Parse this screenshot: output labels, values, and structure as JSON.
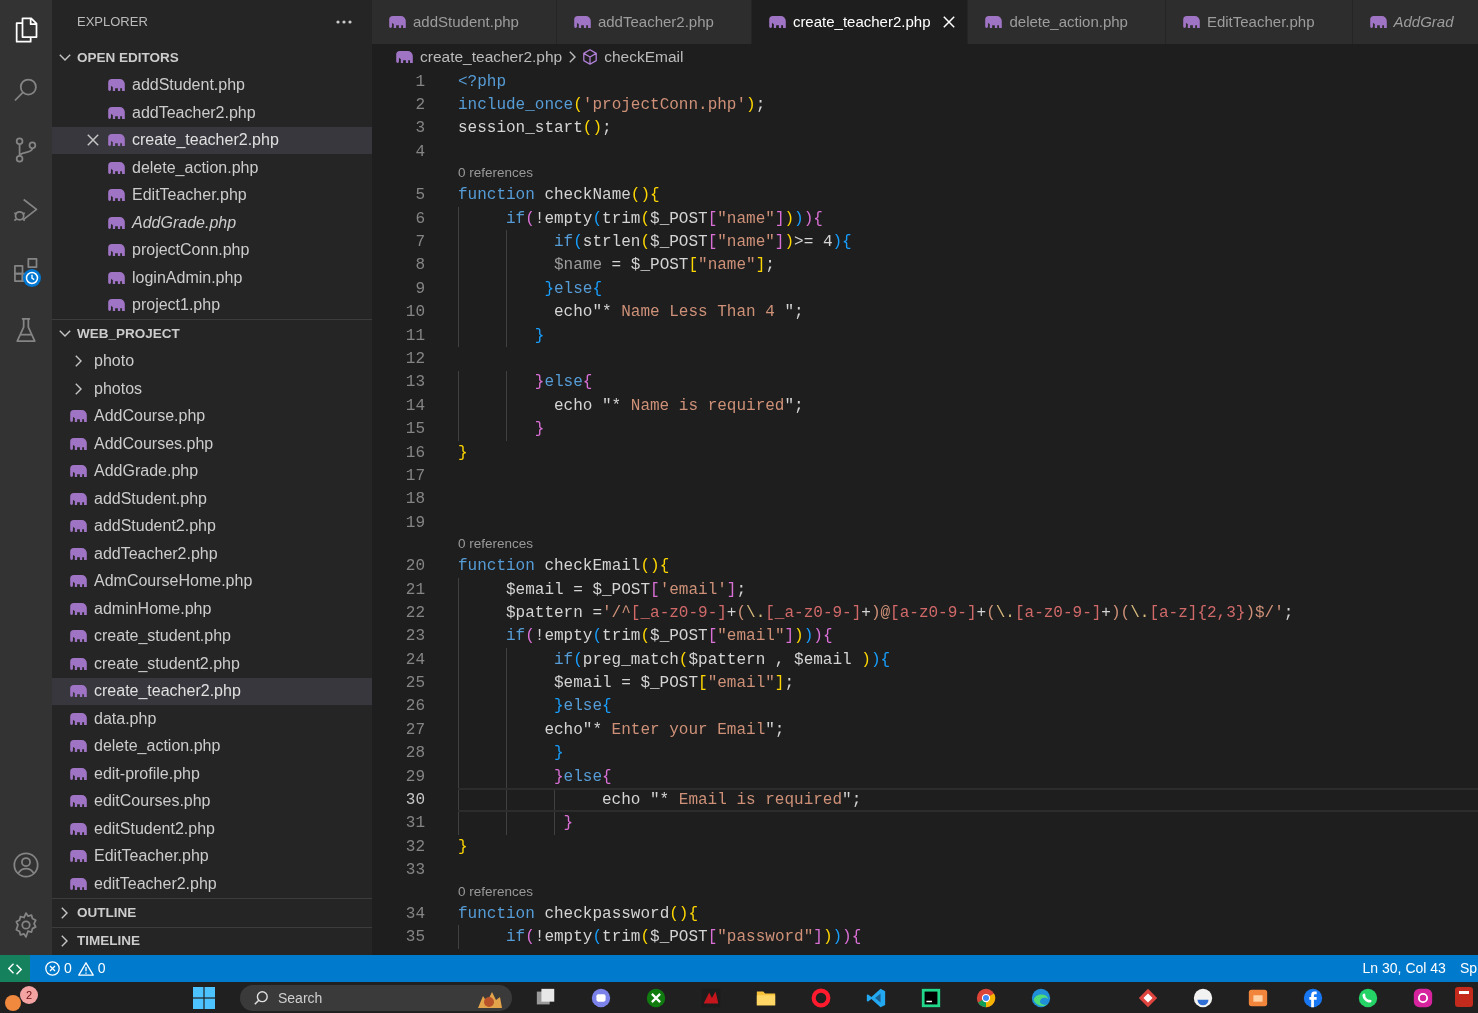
{
  "activity_bar": {
    "items": [
      {
        "kind": "explorer",
        "selected": true
      },
      {
        "kind": "search",
        "selected": false
      },
      {
        "kind": "source_control",
        "selected": false
      },
      {
        "kind": "run_debug",
        "selected": false
      },
      {
        "kind": "extensions",
        "selected": false
      },
      {
        "kind": "testing",
        "selected": false
      }
    ],
    "bottom_items": [
      {
        "kind": "accounts"
      },
      {
        "kind": "settings"
      }
    ]
  },
  "sidebar": {
    "title": "EXPLORER",
    "sections": [
      {
        "kind": "editors",
        "title": "OPEN EDITORS",
        "expanded": true,
        "items": [
          {
            "label": "addStudent.php",
            "selected": false,
            "preview": false
          },
          {
            "label": "addTeacher2.php",
            "selected": false,
            "preview": false
          },
          {
            "label": "create_teacher2.php",
            "selected": true,
            "preview": false
          },
          {
            "label": "delete_action.php",
            "selected": false,
            "preview": false
          },
          {
            "label": "EditTeacher.php",
            "selected": false,
            "preview": false
          },
          {
            "label": "AddGrade.php",
            "selected": false,
            "preview": true
          },
          {
            "label": "projectConn.php",
            "selected": false,
            "preview": false
          },
          {
            "label": "loginAdmin.php",
            "selected": false,
            "preview": false
          },
          {
            "label": "project1.php",
            "selected": false,
            "preview": false
          }
        ]
      },
      {
        "kind": "tree",
        "title": "WEB_PROJECT",
        "expanded": true,
        "items": [
          {
            "kind": "folder",
            "label": "photo",
            "expanded": false,
            "selected": false
          },
          {
            "kind": "folder",
            "label": "photos",
            "expanded": false,
            "selected": false
          },
          {
            "kind": "file",
            "label": "AddCourse.php",
            "selected": false
          },
          {
            "kind": "file",
            "label": "AddCourses.php",
            "selected": false
          },
          {
            "kind": "file",
            "label": "AddGrade.php",
            "selected": false
          },
          {
            "kind": "file",
            "label": "addStudent.php",
            "selected": false
          },
          {
            "kind": "file",
            "label": "addStudent2.php",
            "selected": false
          },
          {
            "kind": "file",
            "label": "addTeacher2.php",
            "selected": false
          },
          {
            "kind": "file",
            "label": "AdmCourseHome.php",
            "selected": false
          },
          {
            "kind": "file",
            "label": "adminHome.php",
            "selected": false
          },
          {
            "kind": "file",
            "label": "create_student.php",
            "selected": false
          },
          {
            "kind": "file",
            "label": "create_student2.php",
            "selected": false
          },
          {
            "kind": "file",
            "label": "create_teacher2.php",
            "selected": true
          },
          {
            "kind": "file",
            "label": "data.php",
            "selected": false
          },
          {
            "kind": "file",
            "label": "delete_action.php",
            "selected": false
          },
          {
            "kind": "file",
            "label": "edit-profile.php",
            "selected": false
          },
          {
            "kind": "file",
            "label": "editCourses.php",
            "selected": false
          },
          {
            "kind": "file",
            "label": "editStudent2.php",
            "selected": false
          },
          {
            "kind": "file",
            "label": "EditTeacher.php",
            "selected": false
          },
          {
            "kind": "file",
            "label": "editTeacher2.php",
            "selected": false
          }
        ]
      },
      {
        "kind": "panel",
        "title": "OUTLINE",
        "expanded": false
      },
      {
        "kind": "panel",
        "title": "TIMELINE",
        "expanded": false
      }
    ]
  },
  "tabs": [
    {
      "label": "addStudent.php",
      "selected": false,
      "preview": false
    },
    {
      "label": "addTeacher2.php",
      "selected": false,
      "preview": false
    },
    {
      "label": "create_teacher2.php",
      "selected": true,
      "preview": false
    },
    {
      "label": "delete_action.php",
      "selected": false,
      "preview": false
    },
    {
      "label": "EditTeacher.php",
      "selected": false,
      "preview": false
    },
    {
      "label": "AddGrad",
      "selected": false,
      "preview": true
    }
  ],
  "breadcrumb": [
    {
      "kind": "file",
      "label": "create_teacher2.php"
    },
    {
      "kind": "function",
      "label": "checkEmail"
    }
  ],
  "editor": {
    "lines": [
      {
        "number": "1",
        "active": false,
        "tokens": [
          {
            "text": "<?php",
            "kind": "keyword"
          }
        ]
      },
      {
        "number": "2",
        "active": false,
        "tokens": [
          {
            "text": "include_once",
            "kind": "keyword"
          },
          {
            "text": "(",
            "kind": "bracket1"
          },
          {
            "text": "'projectConn.php'",
            "kind": "string"
          },
          {
            "text": ")",
            "kind": "bracket1"
          },
          {
            "text": ";",
            "kind": "plain"
          }
        ]
      },
      {
        "number": "3",
        "active": false,
        "tokens": [
          {
            "text": "session_start",
            "kind": "plain"
          },
          {
            "text": "()",
            "kind": "bracket1"
          },
          {
            "text": ";",
            "kind": "plain"
          }
        ]
      },
      {
        "number": "4",
        "active": false
      },
      {
        "number": "5",
        "active": false,
        "lens": "0 references",
        "tokens": [
          {
            "text": "function",
            "kind": "keyword"
          },
          {
            "text": " checkName",
            "kind": "plain"
          },
          {
            "text": "(){",
            "kind": "bracket1"
          }
        ]
      },
      {
        "number": "6",
        "active": false,
        "tokens": [
          {
            "text": "     if",
            "kind": "keyword"
          },
          {
            "text": "(",
            "kind": "bracket2"
          },
          {
            "text": "!empty",
            "kind": "plain"
          },
          {
            "text": "(",
            "kind": "bracket3"
          },
          {
            "text": "trim",
            "kind": "plain"
          },
          {
            "text": "(",
            "kind": "bracket1"
          },
          {
            "text": "$_POST",
            "kind": "plain"
          },
          {
            "text": "[",
            "kind": "bracket2"
          },
          {
            "text": "\"name\"",
            "kind": "string"
          },
          {
            "text": "]",
            "kind": "bracket2"
          },
          {
            "text": ")",
            "kind": "bracket1"
          },
          {
            "text": ")",
            "kind": "bracket3"
          },
          {
            "text": ")",
            "kind": "bracket2"
          },
          {
            "text": "{",
            "kind": "bracket2"
          }
        ]
      },
      {
        "number": "7",
        "active": false,
        "tokens": [
          {
            "text": "          if",
            "kind": "keyword"
          },
          {
            "text": "(",
            "kind": "bracket3"
          },
          {
            "text": "strlen",
            "kind": "plain"
          },
          {
            "text": "(",
            "kind": "bracket1"
          },
          {
            "text": "$_POST",
            "kind": "plain"
          },
          {
            "text": "[",
            "kind": "bracket2"
          },
          {
            "text": "\"name\"",
            "kind": "string"
          },
          {
            "text": "]",
            "kind": "bracket2"
          },
          {
            "text": ")",
            "kind": "bracket1"
          },
          {
            "text": ">= 4",
            "kind": "plain"
          },
          {
            "text": ")",
            "kind": "bracket3"
          },
          {
            "text": "{",
            "kind": "bracket3"
          }
        ]
      },
      {
        "number": "8",
        "active": false,
        "tokens": [
          {
            "text": "          $name",
            "kind": "unused"
          },
          {
            "text": " = $_POST",
            "kind": "plain"
          },
          {
            "text": "[",
            "kind": "bracket1"
          },
          {
            "text": "\"name\"",
            "kind": "string"
          },
          {
            "text": "]",
            "kind": "bracket1"
          },
          {
            "text": ";",
            "kind": "plain"
          }
        ]
      },
      {
        "number": "9",
        "active": false,
        "tokens": [
          {
            "text": "         }",
            "kind": "bracket3"
          },
          {
            "text": "else",
            "kind": "keyword"
          },
          {
            "text": "{",
            "kind": "bracket3"
          }
        ]
      },
      {
        "number": "10",
        "active": false,
        "tokens": [
          {
            "text": "          echo\"* ",
            "kind": "plain"
          },
          {
            "text": "Name Less Than 4 ",
            "kind": "string"
          },
          {
            "text": "\";",
            "kind": "plain"
          }
        ]
      },
      {
        "number": "11",
        "active": false,
        "tokens": [
          {
            "text": "        }",
            "kind": "bracket3"
          }
        ]
      },
      {
        "number": "12",
        "active": false
      },
      {
        "number": "13",
        "active": false,
        "tokens": [
          {
            "text": "        }",
            "kind": "bracket2"
          },
          {
            "text": "else",
            "kind": "keyword"
          },
          {
            "text": "{",
            "kind": "bracket2"
          }
        ]
      },
      {
        "number": "14",
        "active": false,
        "tokens": [
          {
            "text": "          echo \"* ",
            "kind": "plain"
          },
          {
            "text": "Name is required",
            "kind": "string"
          },
          {
            "text": "\";",
            "kind": "plain"
          }
        ]
      },
      {
        "number": "15",
        "active": false,
        "tokens": [
          {
            "text": "        }",
            "kind": "bracket2"
          }
        ]
      },
      {
        "number": "16",
        "active": false,
        "tokens": [
          {
            "text": "}",
            "kind": "bracket1"
          }
        ]
      },
      {
        "number": "17",
        "active": false
      },
      {
        "number": "18",
        "active": false
      },
      {
        "number": "19",
        "active": false
      },
      {
        "number": "20",
        "active": false,
        "lens": "0 references",
        "tokens": [
          {
            "text": "function",
            "kind": "keyword"
          },
          {
            "text": " checkEmail",
            "kind": "plain"
          },
          {
            "text": "(){",
            "kind": "bracket1"
          }
        ]
      },
      {
        "number": "21",
        "active": false,
        "tokens": [
          {
            "text": "     $email = $_POST",
            "kind": "plain"
          },
          {
            "text": "[",
            "kind": "bracket2"
          },
          {
            "text": "'email'",
            "kind": "string"
          },
          {
            "text": "]",
            "kind": "bracket2"
          },
          {
            "text": ";",
            "kind": "plain"
          }
        ]
      },
      {
        "number": "22",
        "active": false,
        "tokens": [
          {
            "text": "     $pattern =",
            "kind": "plain"
          },
          {
            "text": "'/^",
            "kind": "string"
          },
          {
            "text": "[_a-z0-9-]",
            "kind": "regex"
          },
          {
            "text": "+",
            "kind": "plain"
          },
          {
            "text": "(",
            "kind": "string"
          },
          {
            "text": "\\.",
            "kind": "escape"
          },
          {
            "text": "[_a-z0-9-]",
            "kind": "regex"
          },
          {
            "text": "+",
            "kind": "plain"
          },
          {
            "text": ")@",
            "kind": "string"
          },
          {
            "text": "[a-z0-9-]",
            "kind": "regex"
          },
          {
            "text": "+",
            "kind": "plain"
          },
          {
            "text": "(",
            "kind": "string"
          },
          {
            "text": "\\.",
            "kind": "escape"
          },
          {
            "text": "[a-z0-9-]",
            "kind": "regex"
          },
          {
            "text": "+",
            "kind": "plain"
          },
          {
            "text": ")(",
            "kind": "string"
          },
          {
            "text": "\\.",
            "kind": "escape"
          },
          {
            "text": "[a-z]{2,3}",
            "kind": "regex"
          },
          {
            "text": ")$/'",
            "kind": "string"
          },
          {
            "text": ";",
            "kind": "plain"
          }
        ]
      },
      {
        "number": "23",
        "active": false,
        "tokens": [
          {
            "text": "     if",
            "kind": "keyword"
          },
          {
            "text": "(",
            "kind": "bracket2"
          },
          {
            "text": "!empty",
            "kind": "plain"
          },
          {
            "text": "(",
            "kind": "bracket3"
          },
          {
            "text": "trim",
            "kind": "plain"
          },
          {
            "text": "(",
            "kind": "bracket1"
          },
          {
            "text": "$_POST",
            "kind": "plain"
          },
          {
            "text": "[",
            "kind": "bracket2"
          },
          {
            "text": "\"email\"",
            "kind": "string"
          },
          {
            "text": "]",
            "kind": "bracket2"
          },
          {
            "text": ")",
            "kind": "bracket1"
          },
          {
            "text": ")",
            "kind": "bracket3"
          },
          {
            "text": ")",
            "kind": "bracket2"
          },
          {
            "text": "{",
            "kind": "bracket2"
          }
        ]
      },
      {
        "number": "24",
        "active": false,
        "tokens": [
          {
            "text": "          if",
            "kind": "keyword"
          },
          {
            "text": "(",
            "kind": "bracket3"
          },
          {
            "text": "preg_match",
            "kind": "plain"
          },
          {
            "text": "(",
            "kind": "bracket1"
          },
          {
            "text": "$pattern , $email ",
            "kind": "plain"
          },
          {
            "text": ")",
            "kind": "bracket1"
          },
          {
            "text": ")",
            "kind": "bracket3"
          },
          {
            "text": "{",
            "kind": "bracket3"
          }
        ]
      },
      {
        "number": "25",
        "active": false,
        "tokens": [
          {
            "text": "          $email = $_POST",
            "kind": "plain"
          },
          {
            "text": "[",
            "kind": "bracket1"
          },
          {
            "text": "\"email\"",
            "kind": "string"
          },
          {
            "text": "]",
            "kind": "bracket1"
          },
          {
            "text": ";",
            "kind": "plain"
          }
        ]
      },
      {
        "number": "26",
        "active": false,
        "tokens": [
          {
            "text": "          }",
            "kind": "bracket3"
          },
          {
            "text": "else",
            "kind": "keyword"
          },
          {
            "text": "{",
            "kind": "bracket3"
          }
        ]
      },
      {
        "number": "27",
        "active": false,
        "tokens": [
          {
            "text": "         echo\"* ",
            "kind": "plain"
          },
          {
            "text": "Enter your Email",
            "kind": "string"
          },
          {
            "text": "\";",
            "kind": "plain"
          }
        ]
      },
      {
        "number": "28",
        "active": false,
        "tokens": [
          {
            "text": "          }",
            "kind": "bracket3"
          }
        ]
      },
      {
        "number": "29",
        "active": false,
        "tokens": [
          {
            "text": "          }",
            "kind": "bracket2"
          },
          {
            "text": "else",
            "kind": "keyword"
          },
          {
            "text": "{",
            "kind": "bracket2"
          }
        ]
      },
      {
        "number": "30",
        "active": true,
        "tokens": [
          {
            "text": "               echo \"* ",
            "kind": "plain"
          },
          {
            "text": "Email is required",
            "kind": "string"
          },
          {
            "text": "\";",
            "kind": "plain"
          }
        ]
      },
      {
        "number": "31",
        "active": false,
        "tokens": [
          {
            "text": "           }",
            "kind": "bracket2"
          }
        ]
      },
      {
        "number": "32",
        "active": false,
        "tokens": [
          {
            "text": "}",
            "kind": "bracket1"
          }
        ]
      },
      {
        "number": "33",
        "active": false
      },
      {
        "number": "34",
        "active": false,
        "lens": "0 references",
        "tokens": [
          {
            "text": "function",
            "kind": "keyword"
          },
          {
            "text": " checkpassword",
            "kind": "plain"
          },
          {
            "text": "(){",
            "kind": "bracket1"
          }
        ]
      },
      {
        "number": "35",
        "active": false,
        "tokens": [
          {
            "text": "     if",
            "kind": "keyword"
          },
          {
            "text": "(",
            "kind": "bracket2"
          },
          {
            "text": "!empty",
            "kind": "plain"
          },
          {
            "text": "(",
            "kind": "bracket3"
          },
          {
            "text": "trim",
            "kind": "plain"
          },
          {
            "text": "(",
            "kind": "bracket1"
          },
          {
            "text": "$_POST",
            "kind": "plain"
          },
          {
            "text": "[",
            "kind": "bracket2"
          },
          {
            "text": "\"password\"",
            "kind": "string"
          },
          {
            "text": "]",
            "kind": "bracket2"
          },
          {
            "text": ")",
            "kind": "bracket1"
          },
          {
            "text": ")",
            "kind": "bracket3"
          },
          {
            "text": ")",
            "kind": "bracket2"
          },
          {
            "text": "{",
            "kind": "bracket2"
          }
        ]
      }
    ]
  },
  "status_bar": {
    "errors": "0",
    "warnings": "0",
    "cursor": "Ln 30, Col 43",
    "indentation": "Sp"
  },
  "taskbar": {
    "notification_count": "2",
    "search": {
      "placeholder": "Search"
    }
  }
}
